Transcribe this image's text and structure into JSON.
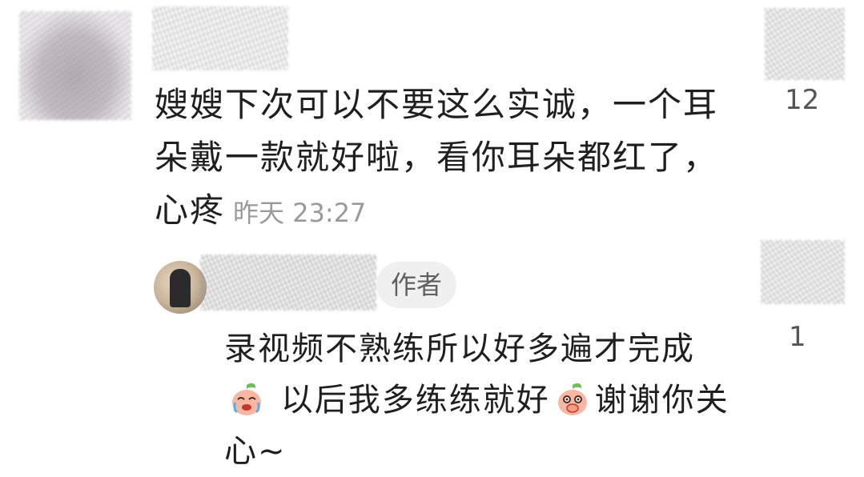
{
  "comment": {
    "text": "嫂嫂下次可以不要这么实诚，一个耳朵戴一款就好啦，看你耳朵都红了，心疼",
    "time": "昨天 23:27",
    "likes": "12"
  },
  "reply": {
    "badge": "作者",
    "text_part1": "录视频不熟练所以好多遍才完成",
    "text_part2": " 以后我多练练就好",
    "text_part3": "谢谢你关心~",
    "emoji1": "crying-laughing-peach-icon",
    "emoji2": "covering-mouth-peach-icon",
    "likes": "1"
  },
  "colors": {
    "text": "#1f1f1f",
    "meta": "#9a9a9a",
    "badge_bg": "#f0f0f0",
    "peach": "#f7b7a3"
  }
}
